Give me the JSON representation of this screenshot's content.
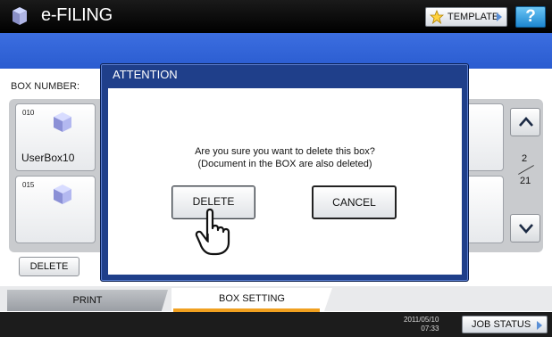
{
  "titlebar": {
    "app_title": "e-FILING",
    "template_label": "TEMPLATE",
    "help_label": "?"
  },
  "main": {
    "box_number_label": "BOX NUMBER:",
    "boxes": [
      {
        "number": "010",
        "name": "UserBox10"
      },
      {
        "number": "015",
        "name": ""
      }
    ],
    "page_current": "2",
    "page_total": "21",
    "delete_label": "DELETE"
  },
  "dialog": {
    "title": "ATTENTION",
    "message_line1": "Are you sure you want to delete this box?",
    "message_line2": "(Document in the BOX are also deleted)",
    "delete_label": "DELETE",
    "cancel_label": "CANCEL"
  },
  "tabs": {
    "print": "PRINT",
    "box_setting": "BOX SETTING"
  },
  "status": {
    "date": "2011/05/10",
    "time": "07:33",
    "job_status": "JOB STATUS"
  },
  "colors": {
    "accent": "#f0a020",
    "header_blue": "#3c6ee0",
    "dialog_blue": "#1f3f8a"
  }
}
